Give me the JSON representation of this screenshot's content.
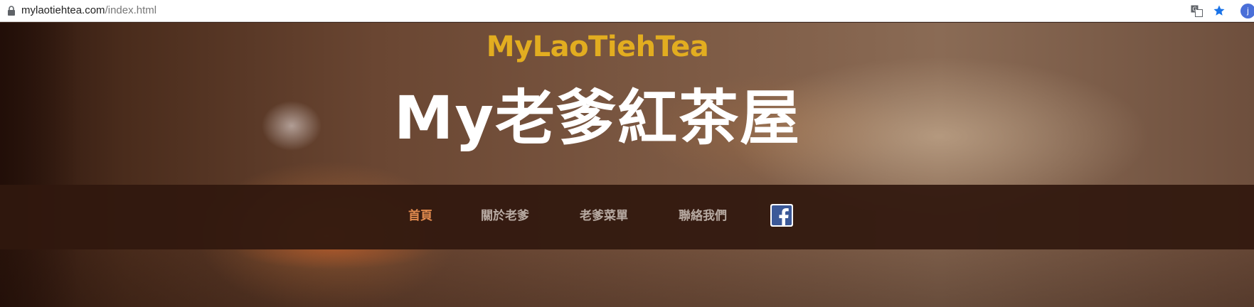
{
  "browser": {
    "url_host": "mylaotiehtea.com",
    "url_path": "/index.html",
    "avatar_letter": "j"
  },
  "hero": {
    "brand": "MyLaoTiehTea",
    "title": "My老爹紅茶屋"
  },
  "nav": {
    "items": [
      {
        "label": "首頁",
        "active": true
      },
      {
        "label": "關於老爹",
        "active": false
      },
      {
        "label": "老爹菜單",
        "active": false
      },
      {
        "label": "聯絡我們",
        "active": false
      }
    ],
    "social_icon": "facebook-icon"
  },
  "colors": {
    "brand": "#e2ad20",
    "nav_active": "#e08a4e",
    "nav_text": "#b7aaa2",
    "nav_bg": "#30180e",
    "facebook_blue": "#3b5998"
  }
}
